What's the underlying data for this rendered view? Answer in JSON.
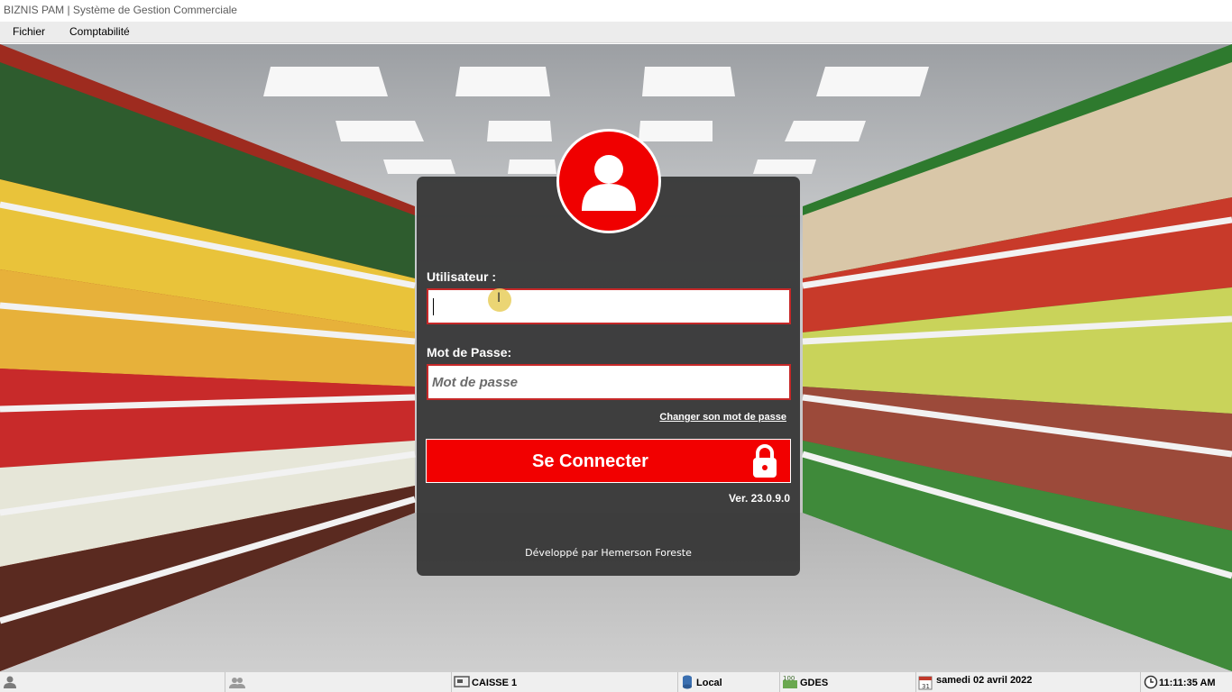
{
  "window": {
    "title": "BIZNIS PAM | Système de Gestion Commerciale"
  },
  "menu": {
    "items": [
      "Fichier",
      "Comptabilité"
    ]
  },
  "login": {
    "user_label": "Utilisateur :",
    "user_value": "",
    "password_label": "Mot de Passe:",
    "password_placeholder": "Mot de passe",
    "change_password_link": "Changer son mot de passe",
    "connect_button": "Se Connecter",
    "version": "Ver. 23.0.9.0",
    "credits": "Développé par Hemerson Foreste"
  },
  "statusbar": {
    "station": "CAISSE 1",
    "server": "Local",
    "currency": "GDES",
    "date": "samedi 02 avril 2022",
    "time": "11:11:35 AM",
    "calendar_day": "31",
    "money_badge": "100"
  },
  "colors": {
    "accent": "#f20000",
    "panel": "#343434",
    "field_border": "#c62828"
  },
  "icons": [
    "user-avatar-icon",
    "padlock-icon",
    "user-status-icon",
    "users-icon",
    "register-icon",
    "database-icon",
    "money-icon",
    "calendar-icon",
    "clock-icon"
  ]
}
